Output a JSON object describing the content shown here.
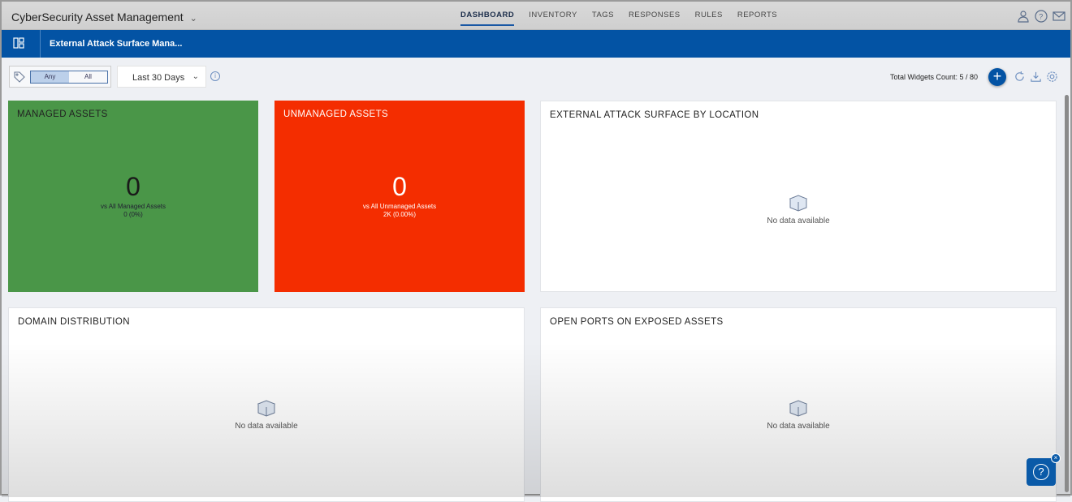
{
  "app": {
    "title": "CyberSecurity Asset Management"
  },
  "nav": [
    "DASHBOARD",
    "INVENTORY",
    "TAGS",
    "RESPONSES",
    "RULES",
    "REPORTS"
  ],
  "dashboard": {
    "title": "External Attack Surface Mana..."
  },
  "toolbar": {
    "any": "Any",
    "all": "All",
    "range": "Last 30 Days",
    "widgets_count": "Total Widgets Count: 5 / 80",
    "add": "+"
  },
  "widgets": {
    "managed": {
      "title": "MANAGED ASSETS",
      "value": "0",
      "label": "vs All Managed Assets",
      "detail": "0 (0%)",
      "color": "#4a9648"
    },
    "unmanaged": {
      "title": "UNMANAGED ASSETS",
      "value": "0",
      "label": "vs All Unmanaged Assets",
      "detail": "2K (0.00%)",
      "color": "#f42d00"
    },
    "location": {
      "title": "EXTERNAL ATTACK SURFACE BY LOCATION",
      "empty": "No data available"
    },
    "domain": {
      "title": "DOMAIN DISTRIBUTION",
      "empty": "No data available"
    },
    "ports": {
      "title": "OPEN PORTS ON EXPOSED ASSETS",
      "empty": "No data available"
    }
  },
  "help": {
    "q": "?",
    "close": "×"
  }
}
